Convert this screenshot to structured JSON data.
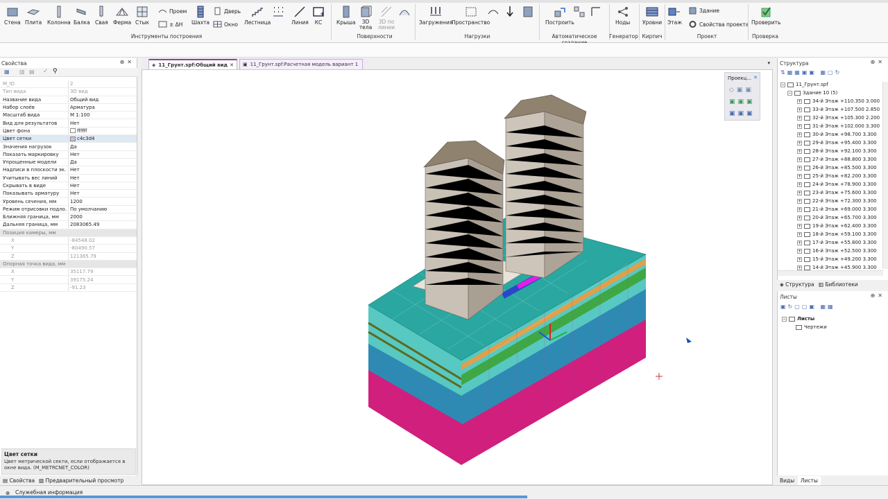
{
  "ribbon": {
    "buttons": {
      "wall": "Стена",
      "slab": "Плита",
      "column": "Колонна",
      "beam": "Балка",
      "pile": "Свая",
      "truss": "Ферма",
      "joint": "Стык",
      "opening": "Проем",
      "delta_h": "± ΔН",
      "shaft": "Шахта",
      "door": "Дверь",
      "window": "Окно",
      "stair": "Лестница",
      "line": "Линия",
      "ks": "КС",
      "roof": "Крыша",
      "body3d": "3D тела",
      "lines3d": "3D по линии",
      "loads": "Загружения",
      "space": "Пространство",
      "build": "Построить",
      "nodes": "Ноды",
      "levels": "Уровни",
      "floor": "Этаж",
      "building": "Здание",
      "proj_props": "Свойства проекта",
      "check": "Проверить"
    },
    "groups": {
      "build_tools": "Инструменты построения",
      "surfaces": "Поверхности",
      "loads": "Нагрузки",
      "auto": "Автоматическое создание",
      "generator": "Генератор",
      "brick": "Кирпич",
      "project": "Проект",
      "check": "Проверка"
    }
  },
  "properties": {
    "title": "Свойства",
    "rows": [
      {
        "k": "M_ID",
        "v": "2",
        "style": "dim"
      },
      {
        "k": "Тип вида",
        "v": "3D вид",
        "style": "dim"
      },
      {
        "k": "Название вида",
        "v": "Общий вид",
        "style": ""
      },
      {
        "k": "Набор слоёв",
        "v": "Арматура",
        "style": ""
      },
      {
        "k": "Масштаб вида",
        "v": "М 1:100",
        "style": ""
      },
      {
        "k": "Вид для результатов",
        "v": "Нет",
        "style": ""
      },
      {
        "k": "Цвет фона",
        "v": "ffffff",
        "style": "",
        "swatch": "#ffffff"
      },
      {
        "k": "Цвет сетки",
        "v": "c4c3d4",
        "style": "sel",
        "swatch": "#c4c3d4"
      },
      {
        "k": "Значения нагрузок",
        "v": "Да",
        "style": ""
      },
      {
        "k": "Показать маркировку",
        "v": "Нет",
        "style": ""
      },
      {
        "k": "Упрощенные модели",
        "v": "Да",
        "style": ""
      },
      {
        "k": "Надписи в плоскости эк...",
        "v": "Нет",
        "style": ""
      },
      {
        "k": "Учитывать вес линий",
        "v": "Нет",
        "style": ""
      },
      {
        "k": "Скрывать в виде",
        "v": "Нет",
        "style": ""
      },
      {
        "k": "Показывать арматуру",
        "v": "Нет",
        "style": ""
      },
      {
        "k": "Уровень сечения, мм",
        "v": "1200",
        "style": ""
      },
      {
        "k": "Режим отрисовки подло...",
        "v": "По умолчанию",
        "style": ""
      },
      {
        "k": "Ближняя граница, мм",
        "v": "2000",
        "style": ""
      },
      {
        "k": "Дальняя граница, мм",
        "v": "2083065.49",
        "style": ""
      },
      {
        "k": "Позиция камеры, мм",
        "v": "",
        "style": "sec"
      },
      {
        "k": "X",
        "v": "-84548.02",
        "style": "dim sub"
      },
      {
        "k": "Y",
        "v": "-80490.57",
        "style": "dim sub"
      },
      {
        "k": "Z",
        "v": "121365.79",
        "style": "dim sub"
      },
      {
        "k": "Опорная точка вида, мм",
        "v": "",
        "style": "sec"
      },
      {
        "k": "X",
        "v": "35117.79",
        "style": "dim sub"
      },
      {
        "k": "Y",
        "v": "39175.24",
        "style": "dim sub"
      },
      {
        "k": "Z",
        "v": "-91.23",
        "style": "dim sub"
      }
    ],
    "desc_title": "Цвет сетки",
    "desc_text": "Цвет метрической секти, если отображается в окне вида. (M_METRCNET_COLOR)",
    "tab_props": "Свойства",
    "tab_preview": "Предварительный просмотр"
  },
  "doc_tabs": [
    {
      "label": "11_Грунт.spf:Общий вид",
      "active": true
    },
    {
      "label": "11_Грунт.spf:Расчетная модель вариант 1",
      "active": false
    }
  ],
  "projection_box": {
    "title": "Проекц..."
  },
  "structure": {
    "title": "Структура",
    "root": "11_Грунт.spf",
    "building": "Здание 10 (5)",
    "floors": [
      "34-й Этаж +110.350  3.000",
      "33-й Этаж +107.500  2.850",
      "32-й Этаж +105.300  2.200",
      "31-й Этаж +102.000  3.300",
      "30-й Этаж +98.700  3.300",
      "29-й Этаж +95.400  3.300",
      "28-й Этаж +92.100  3.300",
      "27-й Этаж +88.800  3.300",
      "26-й Этаж +85.500  3.300",
      "25-й Этаж +82.200  3.300",
      "24-й Этаж +78.900  3.300",
      "23-й Этаж +75.600  3.300",
      "22-й Этаж +72.300  3.300",
      "21-й Этаж +69.000  3.300",
      "20-й Этаж +65.700  3.300",
      "19-й Этаж +62.400  3.300",
      "18-й Этаж +59.100  3.300",
      "17-й Этаж +55.800  3.300",
      "16-й Этаж +52.500  3.300",
      "15-й Этаж +49.200  3.300",
      "14-й Этаж +45.900  3.300"
    ],
    "tab_structure": "Структура",
    "tab_libraries": "Библиотеки"
  },
  "sheets": {
    "title": "Листы",
    "root": "Листы",
    "child": "Чертежи",
    "tab_views": "Виды",
    "tab_sheets": "Листы"
  },
  "status": {
    "service_info": "Служебная информация"
  },
  "colors": {
    "accent": "#8a3fa6",
    "selection": "#dfe8f5",
    "ground_top": "#2aa7a0",
    "ground_bottom": "#d4197a"
  }
}
